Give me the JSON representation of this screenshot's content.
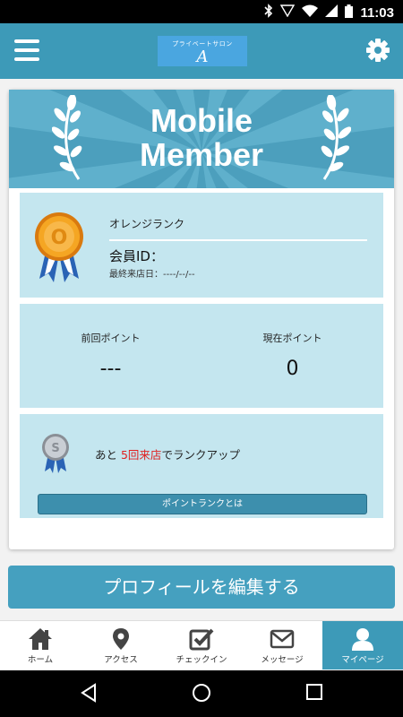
{
  "status_bar": {
    "time": "11:03"
  },
  "app_bar": {
    "logo_small": "プライベートサロン",
    "logo_big": "A"
  },
  "banner": {
    "title_line1": "Mobile",
    "title_line2": "Member"
  },
  "rank": {
    "name": "オレンジランク",
    "medal_letter": "O",
    "member_id_label": "会員ID：",
    "last_visit": "最終来店日：----/--/--"
  },
  "points": {
    "previous_label": "前回ポイント",
    "previous_value": "---",
    "current_label": "現在ポイント",
    "current_value": "0"
  },
  "rank_up": {
    "medal_letter": "S",
    "prefix": "あと ",
    "highlight": "5回来店",
    "suffix": "でランクアップ",
    "button_label": "ポイントランクとは"
  },
  "edit_profile_label": "プロフィールを編集する",
  "tabs": [
    {
      "label": "ホーム",
      "icon": "home-icon"
    },
    {
      "label": "アクセス",
      "icon": "map-pin-icon"
    },
    {
      "label": "チェックイン",
      "icon": "checkin-icon"
    },
    {
      "label": "メッセージ",
      "icon": "envelope-icon"
    },
    {
      "label": "マイページ",
      "icon": "user-icon"
    }
  ],
  "colors": {
    "accent": "#3d9ab8",
    "panel": "#c4e6ef",
    "highlight_red": "#e02020",
    "medal_orange": "#f39c22"
  }
}
